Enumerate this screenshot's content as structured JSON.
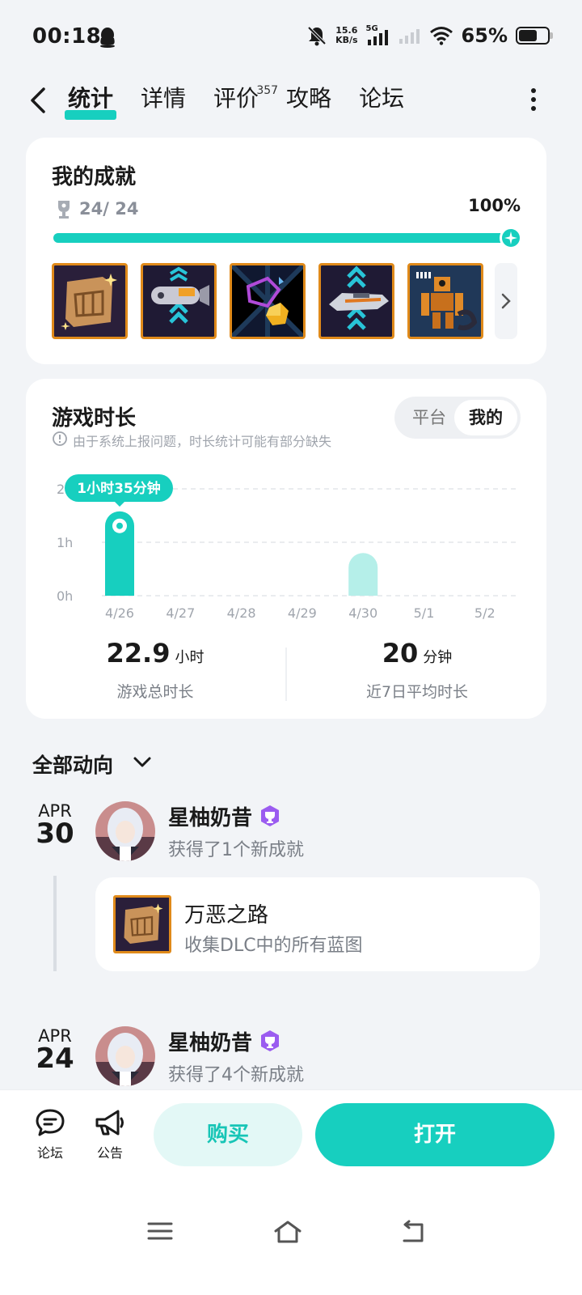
{
  "status_bar": {
    "time": "00:18",
    "net_speed_value": "15.6",
    "net_speed_unit": "KB/s",
    "network": "5G",
    "battery_pct": "65%",
    "battery_level": 0.65
  },
  "nav": {
    "tabs": [
      {
        "label": "统计",
        "active": true
      },
      {
        "label": "详情"
      },
      {
        "label": "评价",
        "badge": "357"
      },
      {
        "label": "攻略"
      },
      {
        "label": "论坛"
      }
    ]
  },
  "achievements": {
    "title": "我的成就",
    "count": "24/ 24",
    "percent": "100%",
    "progress": 1.0
  },
  "playtime": {
    "title": "游戏时长",
    "note": "由于系统上报问题，时长统计可能有部分缺失",
    "segment": {
      "platform": "平台",
      "mine": "我的"
    },
    "tooltip": "1小时35分钟",
    "total_value": "22.9",
    "total_unit": "小时",
    "total_label": "游戏总时长",
    "avg_value": "20",
    "avg_unit": "分钟",
    "avg_label": "近7日平均时长"
  },
  "chart_data": {
    "type": "bar",
    "categories": [
      "4/26",
      "4/27",
      "4/28",
      "4/29",
      "4/30",
      "5/1",
      "5/2"
    ],
    "values": [
      1.58,
      0,
      0,
      0,
      0.8,
      0,
      0
    ],
    "yticks": [
      "0h",
      "1h",
      "2h"
    ],
    "ylim": [
      0,
      2
    ],
    "highlight_index": 0,
    "colors": {
      "highlight": "#17cfbf",
      "normal": "#b5efe9"
    }
  },
  "feed": {
    "header": "全部动向",
    "entries": [
      {
        "month": "APR",
        "day": "30",
        "user": "星柚奶昔",
        "action": "获得了1个新成就"
      },
      {
        "month": "APR",
        "day": "24",
        "user": "星柚奶昔",
        "action": "获得了4个新成就"
      }
    ],
    "achievement": {
      "name": "万恶之路",
      "desc": "收集DLC中的所有蓝图"
    }
  },
  "bottom": {
    "forum": "论坛",
    "notice": "公告",
    "buy": "购买",
    "open": "打开"
  },
  "colors": {
    "accent": "#17cfbf",
    "badge_border": "#e08a1a",
    "vip": "#9b5cf0"
  }
}
